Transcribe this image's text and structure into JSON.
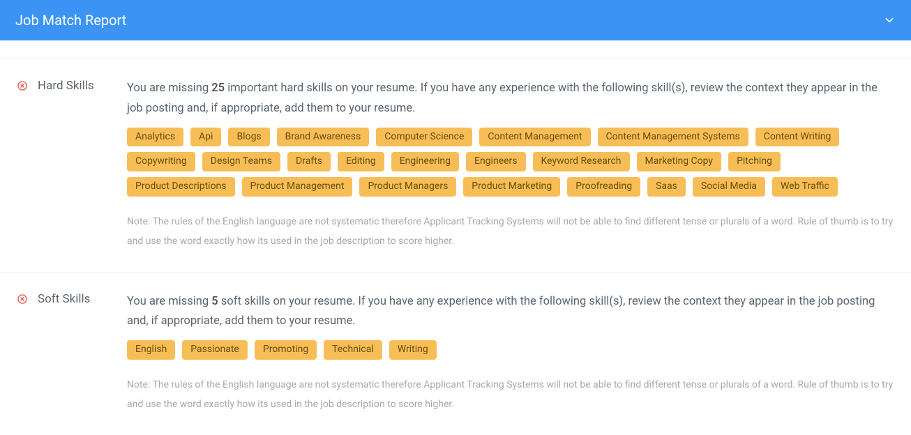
{
  "header": {
    "title": "Job Match Report"
  },
  "sections": [
    {
      "label": "Hard Skills",
      "summary_pre": "You are missing ",
      "count": "25",
      "summary_mid": " important hard skills on your resume. ",
      "summary_post": "If you have any experience with the following skill(s), review the context they appear in the job posting and, if appropriate, add them to your resume.",
      "tags": [
        "Analytics",
        "Api",
        "Blogs",
        "Brand Awareness",
        "Computer Science",
        "Content Management",
        "Content Management Systems",
        "Content Writing",
        "Copywriting",
        "Design Teams",
        "Drafts",
        "Editing",
        "Engineering",
        "Engineers",
        "Keyword Research",
        "Marketing Copy",
        "Pitching",
        "Product Descriptions",
        "Product Management",
        "Product Managers",
        "Product Marketing",
        "Proofreading",
        "Saas",
        "Social Media",
        "Web Traffic"
      ],
      "note": "Note: The rules of the English language are not systematic therefore Applicant Tracking Systems will not be able to find different tense or plurals of a word. Rule of thumb is to try and use the word exactly how its used in the job description to score higher."
    },
    {
      "label": "Soft Skills",
      "summary_pre": "You are missing ",
      "count": "5",
      "summary_mid": " soft skills on your resume. ",
      "summary_post": "If you have any experience with the following skill(s), review the context they appear in the job posting and, if appropriate, add them to your resume.",
      "tags": [
        "English",
        "Passionate",
        "Promoting",
        "Technical",
        "Writing"
      ],
      "note": "Note: The rules of the English language are not systematic therefore Applicant Tracking Systems will not be able to find different tense or plurals of a word. Rule of thumb is to try and use the word exactly how its used in the job description to score higher."
    }
  ]
}
